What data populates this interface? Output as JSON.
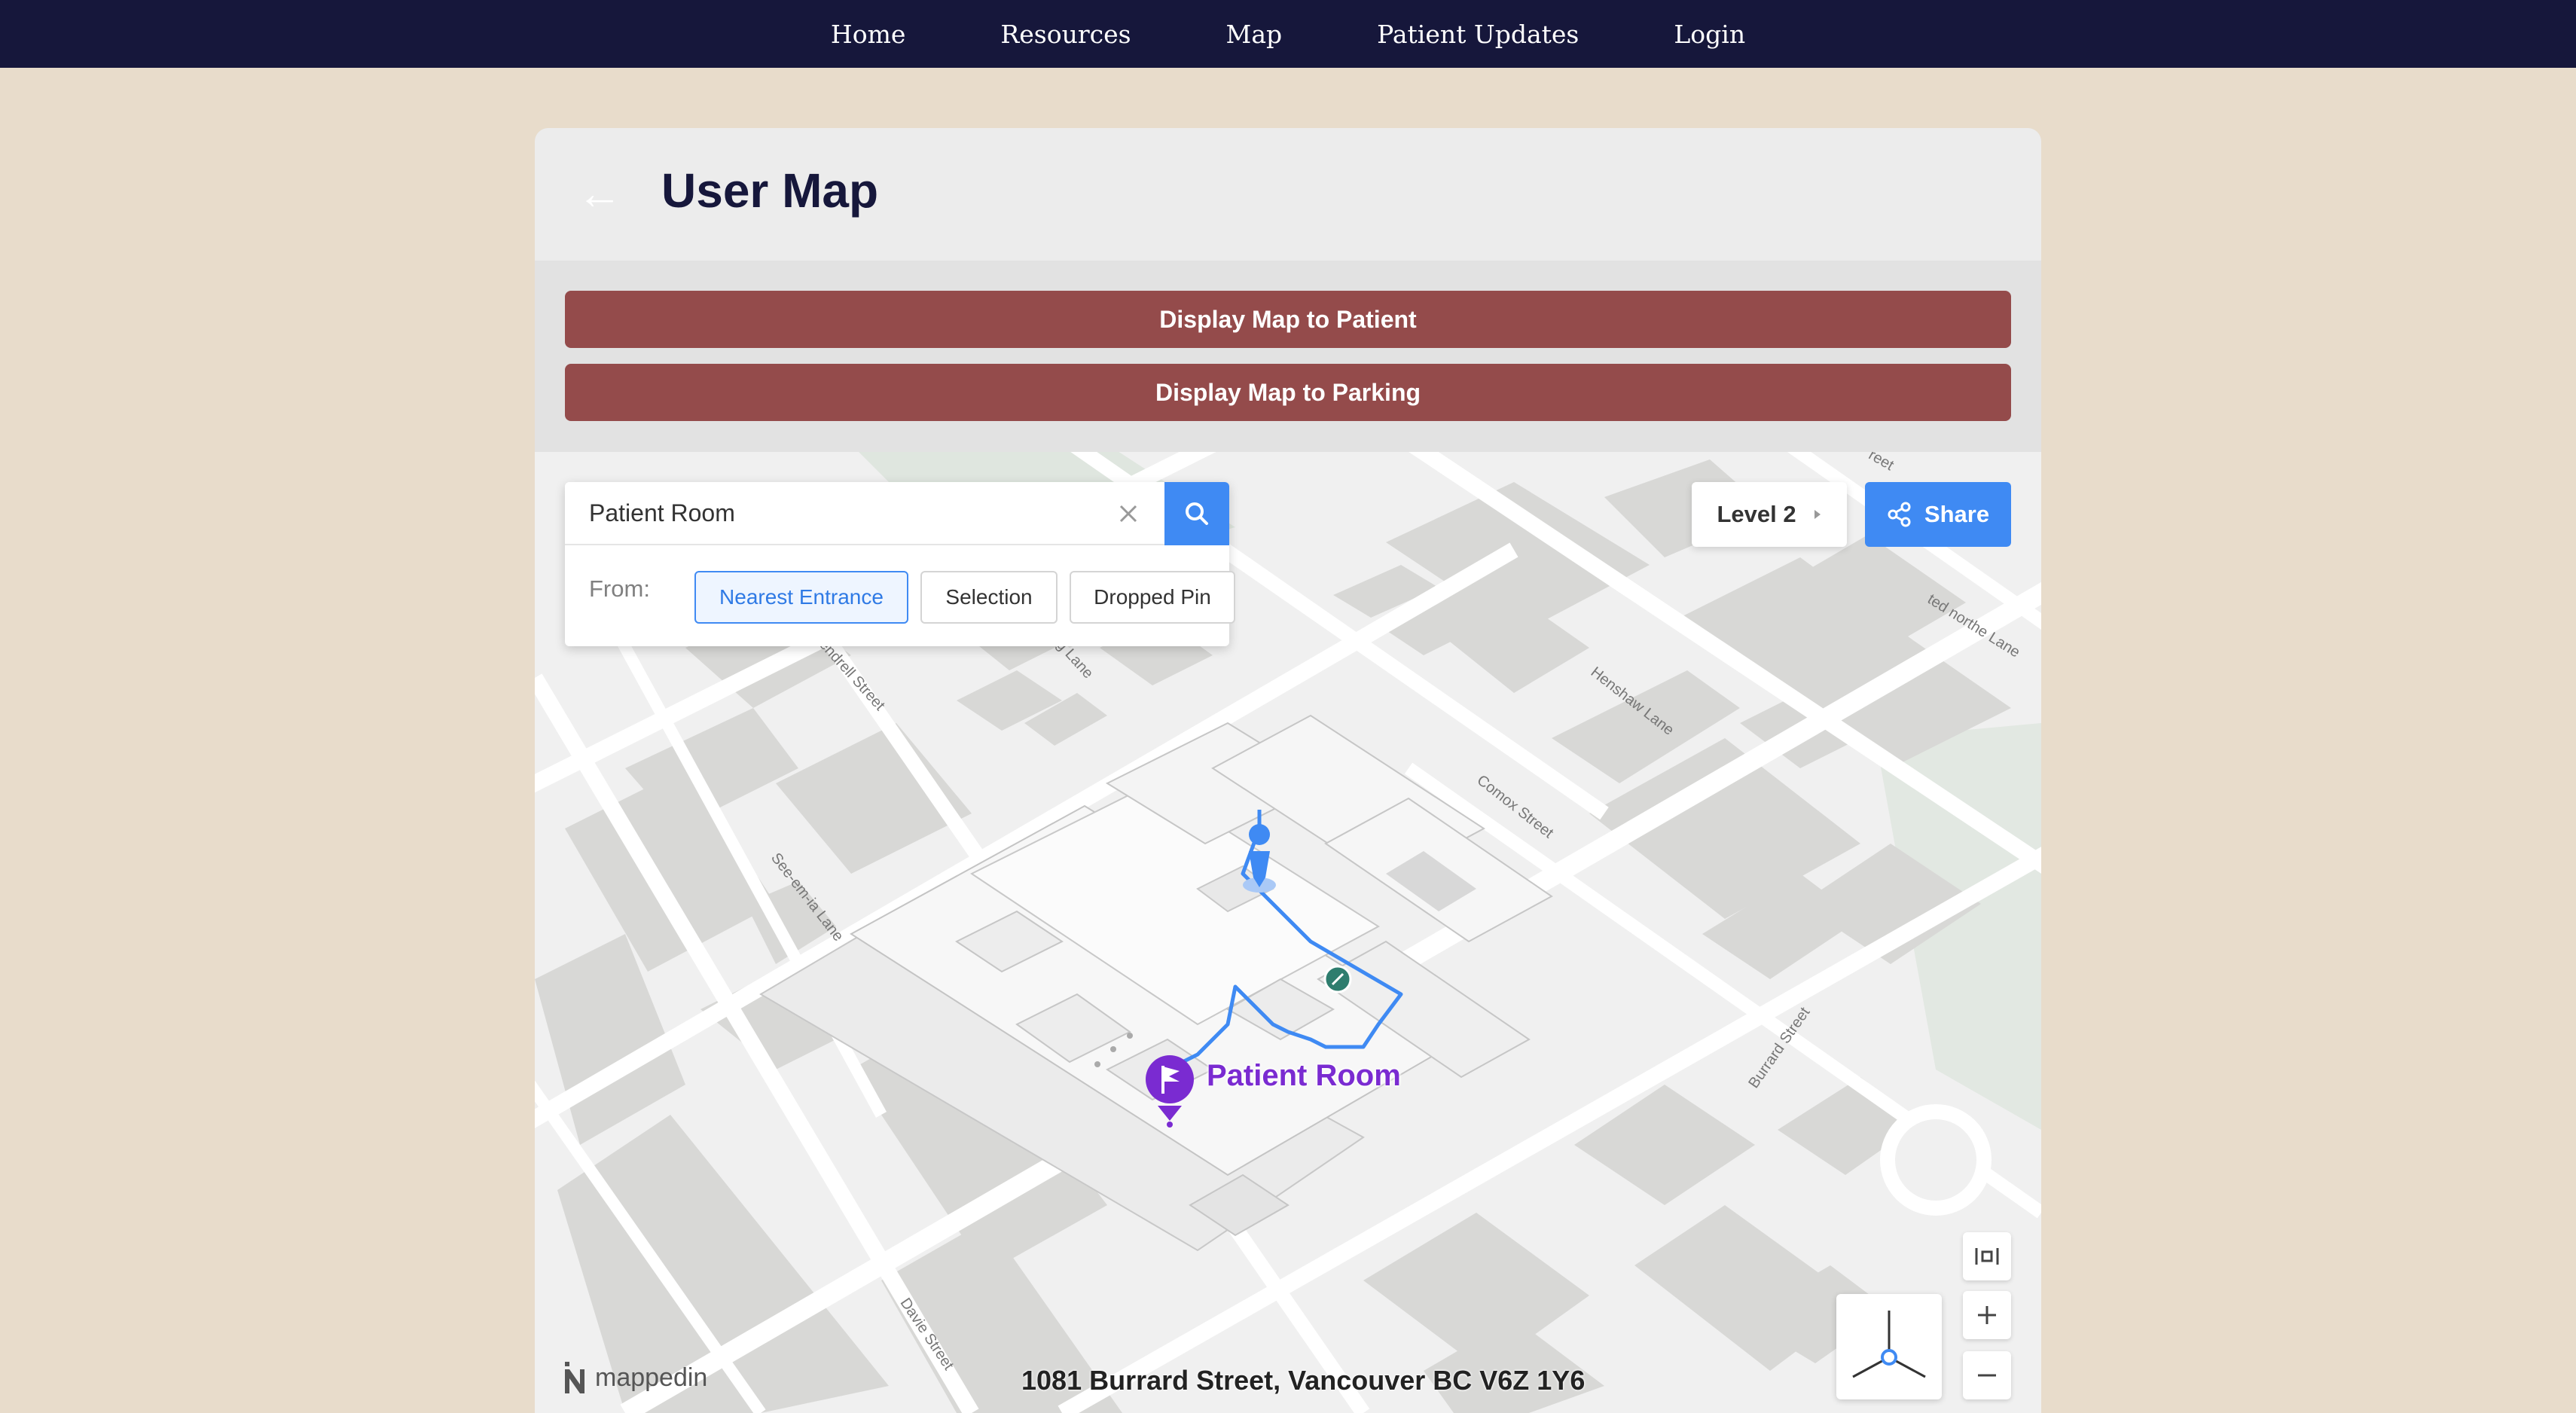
{
  "nav": {
    "items": [
      {
        "label": "Home"
      },
      {
        "label": "Resources"
      },
      {
        "label": "Map"
      },
      {
        "label": "Patient Updates"
      },
      {
        "label": "Login"
      }
    ]
  },
  "header": {
    "back_arrow": "←",
    "title": "User Map"
  },
  "actions": {
    "patient_label": "Display Map to Patient",
    "parking_label": "Display Map to Parking"
  },
  "map": {
    "search": {
      "value": "Patient Room",
      "clear_icon": "close-icon",
      "search_icon": "search-icon"
    },
    "from": {
      "label": "From:",
      "options": [
        "Nearest Entrance",
        "Selection",
        "Dropped Pin"
      ],
      "selected": "Nearest Entrance"
    },
    "level": {
      "label": "Level 2",
      "icon": "caret-right-icon"
    },
    "share": {
      "label": "Share",
      "icon": "share-icon"
    },
    "poi_label": "Patient Room",
    "address": "1081 Burrard Street, Vancouver BC V6Z 1Y6",
    "logo_text": "mappedin",
    "streets": [
      "Pendrell Street",
      "Henshaw Lane",
      "Comox Street",
      "See-em-ia Lane",
      "Burrard Street",
      "Davie Street",
      "ted northe Lane",
      "g Lane",
      "reet"
    ],
    "colors": {
      "accent": "#3f8af3",
      "action": "#944b4b",
      "nav": "#16173b",
      "poi": "#7a2bd1"
    }
  }
}
